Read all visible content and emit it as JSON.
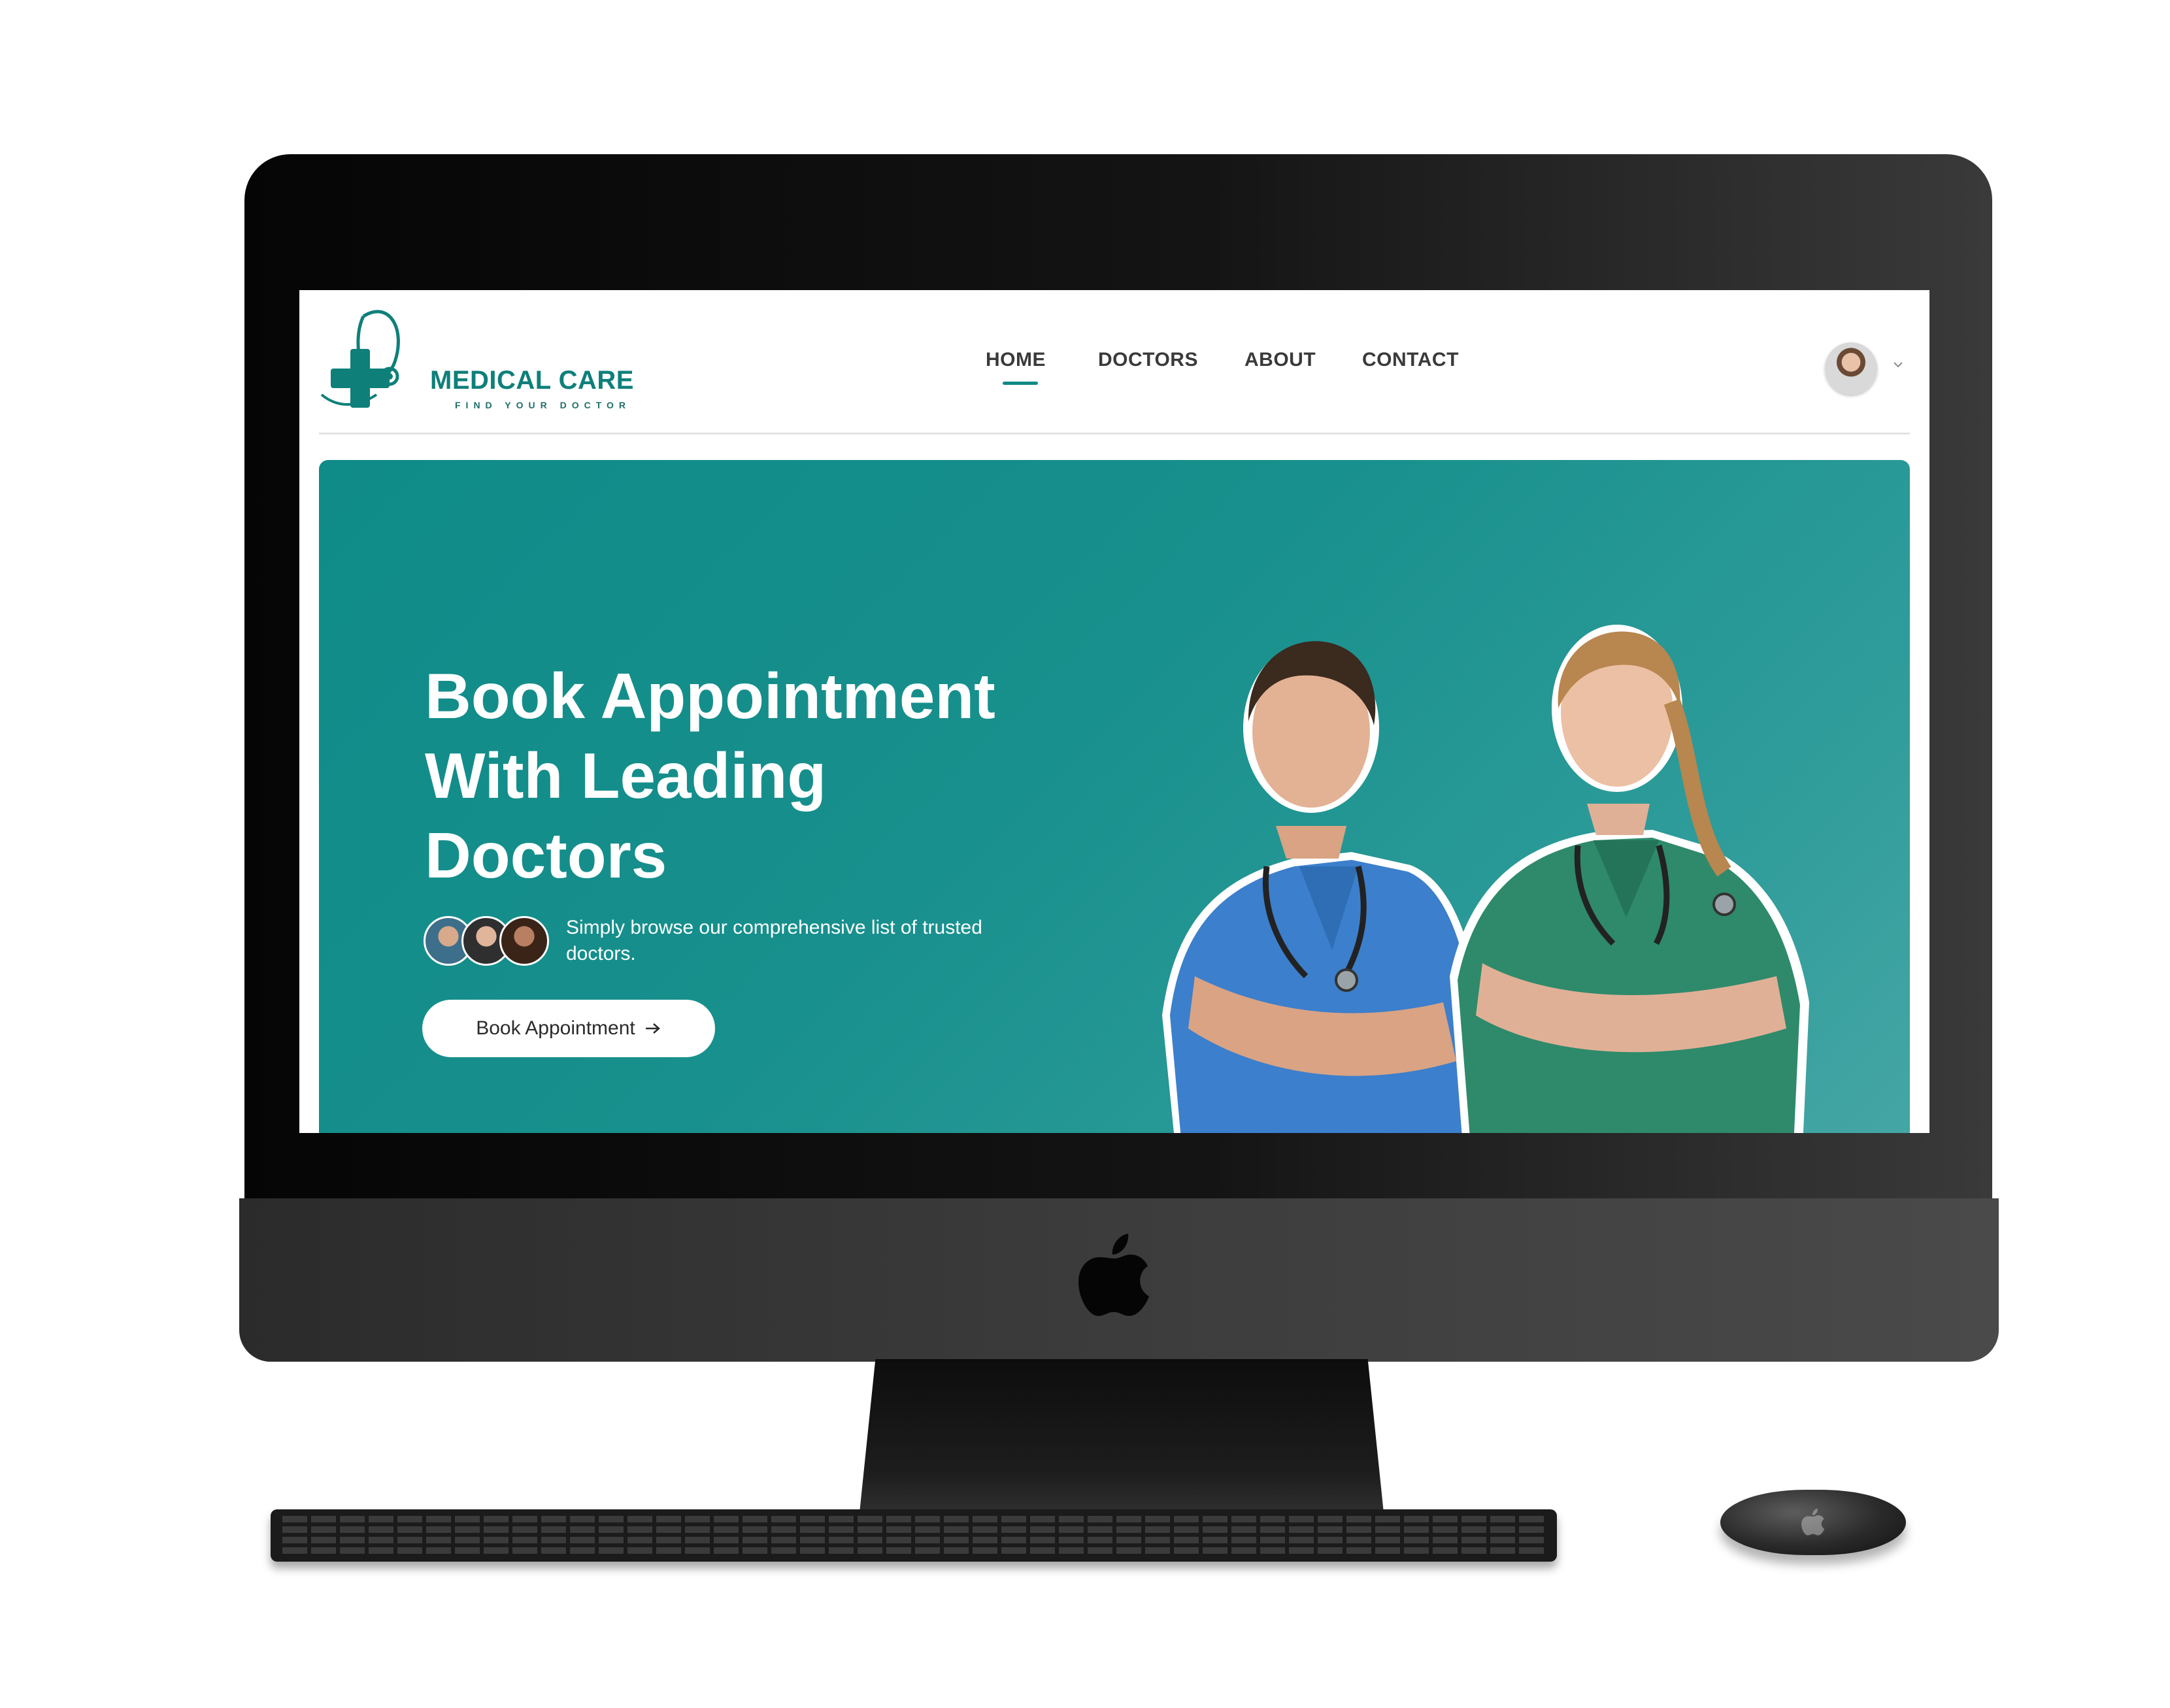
{
  "brand": {
    "name": "MEDICAL CARE",
    "tagline": "FIND YOUR DOCTOR",
    "color": "#0f7f7a"
  },
  "nav": {
    "items": [
      {
        "label": "HOME",
        "active": true
      },
      {
        "label": "DOCTORS",
        "active": false
      },
      {
        "label": "ABOUT",
        "active": false
      },
      {
        "label": "CONTACT",
        "active": false
      }
    ],
    "accent": "#0f8a85"
  },
  "profile": {
    "avatar_icon": "user-avatar",
    "caret_icon": "chevron-down-icon"
  },
  "hero": {
    "title_line1": "Book Appointment",
    "title_line2": "With Leading",
    "title_line3": "Doctors",
    "subtitle": "Simply browse our comprehensive list of trusted doctors.",
    "cta_label": "Book Appointment",
    "cta_icon": "arrow-right-icon",
    "background": "#14908d"
  },
  "device": {
    "logo_icon": "apple-logo-icon"
  }
}
